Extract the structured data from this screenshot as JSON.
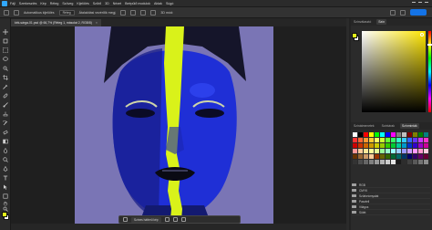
{
  "menubar": {
    "items": [
      "Fájl",
      "Szerkesztés",
      "Kép",
      "Réteg",
      "Szöveg",
      "Kijelölés",
      "Szűrő",
      "3D",
      "Nézet",
      "Beépülő modulok",
      "Ablak",
      "Súgó"
    ]
  },
  "options": {
    "auto_select_label": "Automatikus kijelölés",
    "auto_select_value": "Réteg",
    "transform_label": "Átalakítási vezérlők megj.",
    "mode_3d_label": "3D mód:",
    "share_label": "Megosztás"
  },
  "document": {
    "tab_title": "kék-sárga-01.psd @ 66,7% (Réteg 1, másolat 2, RGB/8)",
    "close_glyph": "×"
  },
  "panels": {
    "color_tabs": [
      "Színválasztó",
      "Szín"
    ],
    "swatch_tabs": [
      "Színátmenetek",
      "Színtárak",
      "Színminták"
    ],
    "swatches": [
      "#ffffff",
      "#000000",
      "#ff0000",
      "#ffff00",
      "#00ff00",
      "#00ffff",
      "#0000ff",
      "#ff00ff",
      "#808080",
      "#c0c0c0",
      "#800000",
      "#808000",
      "#008000",
      "#008080",
      "#ff3333",
      "#ff6633",
      "#ff9933",
      "#ffcc33",
      "#ffff66",
      "#ccff33",
      "#66ff33",
      "#33ff66",
      "#33ffcc",
      "#33ccff",
      "#3366ff",
      "#6633ff",
      "#cc33ff",
      "#ff33cc",
      "#cc0000",
      "#cc3300",
      "#cc6600",
      "#cc9900",
      "#cccc00",
      "#99cc00",
      "#33cc00",
      "#00cc33",
      "#00cc99",
      "#0099cc",
      "#0033cc",
      "#3300cc",
      "#9900cc",
      "#cc0099",
      "#ff9999",
      "#ffcc99",
      "#ffe699",
      "#ffff99",
      "#e6ff99",
      "#99ff99",
      "#99ffcc",
      "#99ffff",
      "#99ccff",
      "#9999ff",
      "#cc99ff",
      "#ff99ff",
      "#ff99cc",
      "#ffccdd",
      "#663300",
      "#996633",
      "#cc9966",
      "#ffcc99",
      "#993300",
      "#666600",
      "#336600",
      "#006633",
      "#006666",
      "#003366",
      "#000066",
      "#330066",
      "#660066",
      "#660033",
      "#333333",
      "#4d4d4d",
      "#666666",
      "#808080",
      "#999999",
      "#b3b3b3",
      "#cccccc",
      "#e6e6e6",
      "#1a1a1a",
      "#2d2d2d",
      "#404040",
      "#595959",
      "#737373",
      "#8c8c8c"
    ],
    "folders": [
      "RGB",
      "CMYK",
      "Szürkeárnyalat",
      "Pasztell",
      "Világos",
      "Sötét"
    ]
  },
  "floating_bar": {
    "label": "Színes hátterű kép"
  },
  "colors": {
    "foreground": "#e0f21a",
    "background": "#ffffff",
    "canvas_bg": "#7a75b5",
    "accent": "#1473e6"
  },
  "icons": [
    "move-tool-icon",
    "artboard-tool-icon",
    "marquee-tool-icon",
    "lasso-tool-icon",
    "quick-select-tool-icon",
    "crop-tool-icon",
    "eyedropper-tool-icon",
    "healing-brush-icon",
    "brush-tool-icon",
    "clone-stamp-icon",
    "history-brush-icon",
    "eraser-tool-icon",
    "gradient-tool-icon",
    "blur-tool-icon",
    "dodge-tool-icon",
    "pen-tool-icon",
    "type-tool-icon",
    "path-select-icon",
    "shape-tool-icon",
    "hand-tool-icon",
    "zoom-tool-icon"
  ]
}
